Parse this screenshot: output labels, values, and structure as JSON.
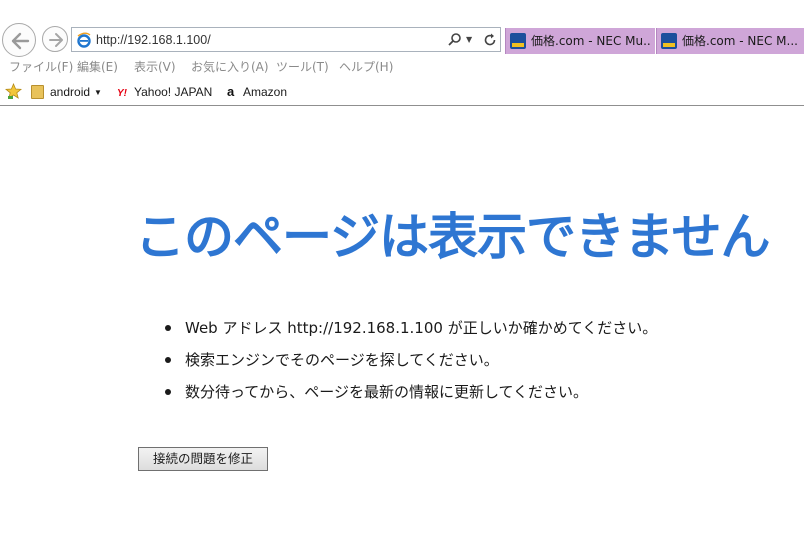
{
  "browser": {
    "address": "http://192.168.1.100/",
    "tabs": [
      {
        "label": "価格.com - NEC Mu..."
      },
      {
        "label": "価格.com - NEC M..."
      }
    ],
    "menu": [
      "ファイル(F)",
      "編集(E)",
      "表示(V)",
      "お気に入り(A)",
      "ツール(T)",
      "ヘルプ(H)"
    ],
    "favorites": {
      "folder": "android",
      "yahoo_label": "Yahoo! JAPAN",
      "amazon_label": "Amazon"
    }
  },
  "page": {
    "title": "このページは表示できません",
    "bullets": [
      "Web アドレス http://192.168.1.100 が正しいか確かめてください。",
      "検索エンジンでそのページを探してください。",
      "数分待ってから、ページを最新の情報に更新してください。"
    ],
    "fix_button": "接続の問題を修正"
  },
  "colors": {
    "title": "#2e76d2",
    "tab_background": "#cfa6d8"
  },
  "icons": {
    "back": "back-arrow-icon",
    "forward": "forward-arrow-icon",
    "site": "ie-logo-icon",
    "search": "search-icon",
    "refresh": "refresh-icon",
    "favorites": "favorites-star-icon"
  }
}
